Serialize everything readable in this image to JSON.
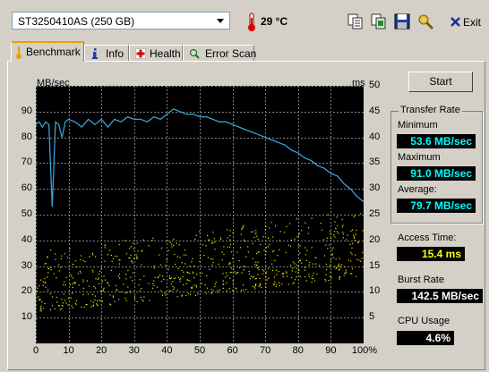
{
  "toolbar": {
    "drive": "ST3250410AS (250 GB)",
    "temperature": "29 °C",
    "exit_label": "Exit"
  },
  "tabs": [
    {
      "label": "Benchmark",
      "icon": "thermometer-icon",
      "active": true
    },
    {
      "label": "Info",
      "icon": "info-icon",
      "active": false
    },
    {
      "label": "Health",
      "icon": "health-cross-icon",
      "active": false
    },
    {
      "label": "Error Scan",
      "icon": "magnifier-icon",
      "active": false
    }
  ],
  "panel": {
    "start_label": "Start",
    "transfer_rate_title": "Transfer Rate",
    "minimum_label": "Minimum",
    "minimum_value": "53.6 MB/sec",
    "maximum_label": "Maximum",
    "maximum_value": "91.0 MB/sec",
    "average_label": "Average:",
    "average_value": "79.7 MB/sec",
    "access_time_label": "Access Time:",
    "access_time_value": "15.4 ms",
    "burst_rate_label": "Burst Rate",
    "burst_rate_value": "142.5 MB/sec",
    "cpu_usage_label": "CPU Usage",
    "cpu_usage_value": "4.6%"
  },
  "colors": {
    "transfer_value": "#00ffff",
    "access_value": "#ffff00",
    "other_value": "#ffffff",
    "line": "#3a9fd6",
    "scatter": "#e6e600",
    "grid": "#808080"
  },
  "chart_data": {
    "type": "line",
    "ylabel_left": "MB/sec",
    "ylabel_right": "ms",
    "xlim": [
      0,
      100
    ],
    "ylim_left": [
      0,
      100
    ],
    "ylim_right": [
      0,
      50
    ],
    "x_ticks": [
      "0",
      "10",
      "20",
      "30",
      "40",
      "50",
      "60",
      "70",
      "80",
      "90",
      "100%"
    ],
    "y_ticks_left": [
      "10",
      "20",
      "30",
      "40",
      "50",
      "60",
      "70",
      "80",
      "90"
    ],
    "y_ticks_right": [
      "5",
      "10",
      "15",
      "20",
      "25",
      "30",
      "35",
      "40",
      "45",
      "50"
    ],
    "grid": true,
    "series": [
      {
        "name": "Transfer Rate",
        "axis": "left",
        "x": [
          0,
          1,
          2,
          3,
          4,
          5,
          6,
          7,
          8,
          9,
          10,
          12,
          14,
          16,
          18,
          20,
          22,
          24,
          26,
          28,
          30,
          32,
          34,
          36,
          38,
          40,
          42,
          44,
          46,
          48,
          50,
          52,
          54,
          56,
          58,
          60,
          62,
          64,
          66,
          68,
          70,
          72,
          74,
          76,
          78,
          80,
          82,
          84,
          86,
          88,
          90,
          92,
          94,
          96,
          98,
          100
        ],
        "y": [
          85,
          86,
          84,
          86,
          85,
          53,
          86,
          85,
          80,
          86,
          87,
          86,
          84,
          87,
          85,
          87,
          84,
          87,
          86,
          88,
          87,
          87,
          86,
          88,
          87,
          89,
          91,
          90,
          89,
          89,
          88,
          88,
          87,
          86,
          86,
          85,
          84,
          83,
          82,
          81,
          80,
          79,
          78,
          77,
          75,
          74,
          72,
          71,
          69,
          68,
          66,
          65,
          62,
          60,
          57,
          55
        ]
      },
      {
        "name": "Access Time",
        "axis": "right",
        "type": "scatter",
        "x_range": [
          0,
          100
        ],
        "y_band_start": [
          6,
          18
        ],
        "y_band_end": [
          13,
          26
        ]
      }
    ]
  }
}
